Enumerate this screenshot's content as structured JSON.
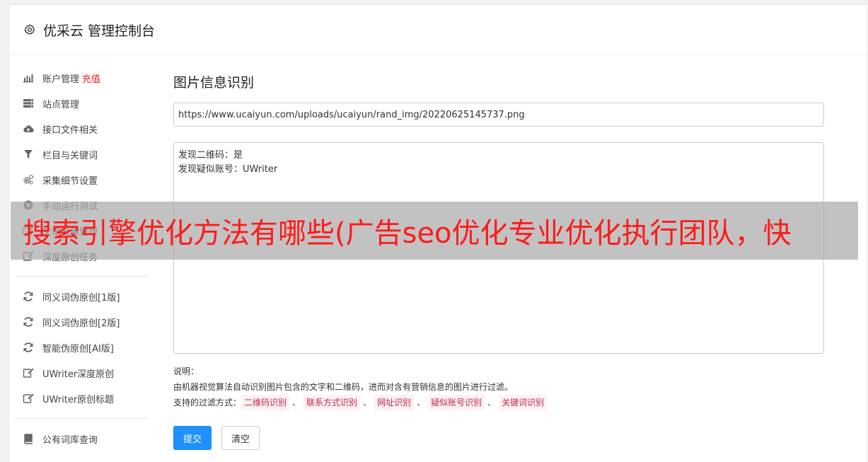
{
  "header": {
    "title": "优采云 管理控制台"
  },
  "sidebar": {
    "group1": [
      {
        "icon": "bar-chart-icon",
        "label": "账户管理",
        "highlight": "充值"
      },
      {
        "icon": "server-icon",
        "label": "站点管理"
      },
      {
        "icon": "cloud-upload-icon",
        "label": "接口文件相关"
      },
      {
        "icon": "filter-icon",
        "label": "栏目与关键词"
      },
      {
        "icon": "cogs-icon",
        "label": "采集细节设置"
      },
      {
        "icon": "play-circle-icon",
        "label": "手动运行测试"
      },
      {
        "icon": "edit-icon",
        "label": "文章批量管理"
      },
      {
        "icon": "edit-icon",
        "label": "深度原创任务"
      }
    ],
    "group2": [
      {
        "icon": "refresh-icon",
        "label": "同义词伪原创[1版]"
      },
      {
        "icon": "refresh-icon",
        "label": "同义词伪原创[2版]"
      },
      {
        "icon": "refresh-icon",
        "label": "智能伪原创[AI版]"
      },
      {
        "icon": "edit-icon",
        "label": "UWriter深度原创"
      },
      {
        "icon": "edit-icon",
        "label": "UWriter原创标题"
      }
    ],
    "group3": [
      {
        "icon": "book-icon",
        "label": "公有词库查询"
      }
    ]
  },
  "main": {
    "title": "图片信息识别",
    "url_value": "https://www.ucaiyun.com/uploads/ucaiyun/rand_img/20220625145737.png",
    "result_line1": "发现二维码：是",
    "result_line2": "发现疑似账号：UWriter",
    "desc_label": "说明：",
    "desc_text": "由机器视觉算法自动识别图片包含的文字和二维码，进而对含有营销信息的图片进行过滤。",
    "filter_label": "支持的过滤方式：",
    "filters": [
      "二维码识别",
      "联系方式识别",
      "网址识别",
      "疑似账号识别",
      "关键词识别"
    ],
    "filter_sep": "、",
    "submit_label": "提交",
    "clear_label": "清空"
  },
  "banner": {
    "text": "搜索引擎优化方法有哪些(广告seo优化专业优化执行团队，快"
  },
  "colors": {
    "accent": "#1e90ff",
    "highlight": "#e02020",
    "tag_text": "#c7254e",
    "banner_text": "#ff1a1a"
  }
}
